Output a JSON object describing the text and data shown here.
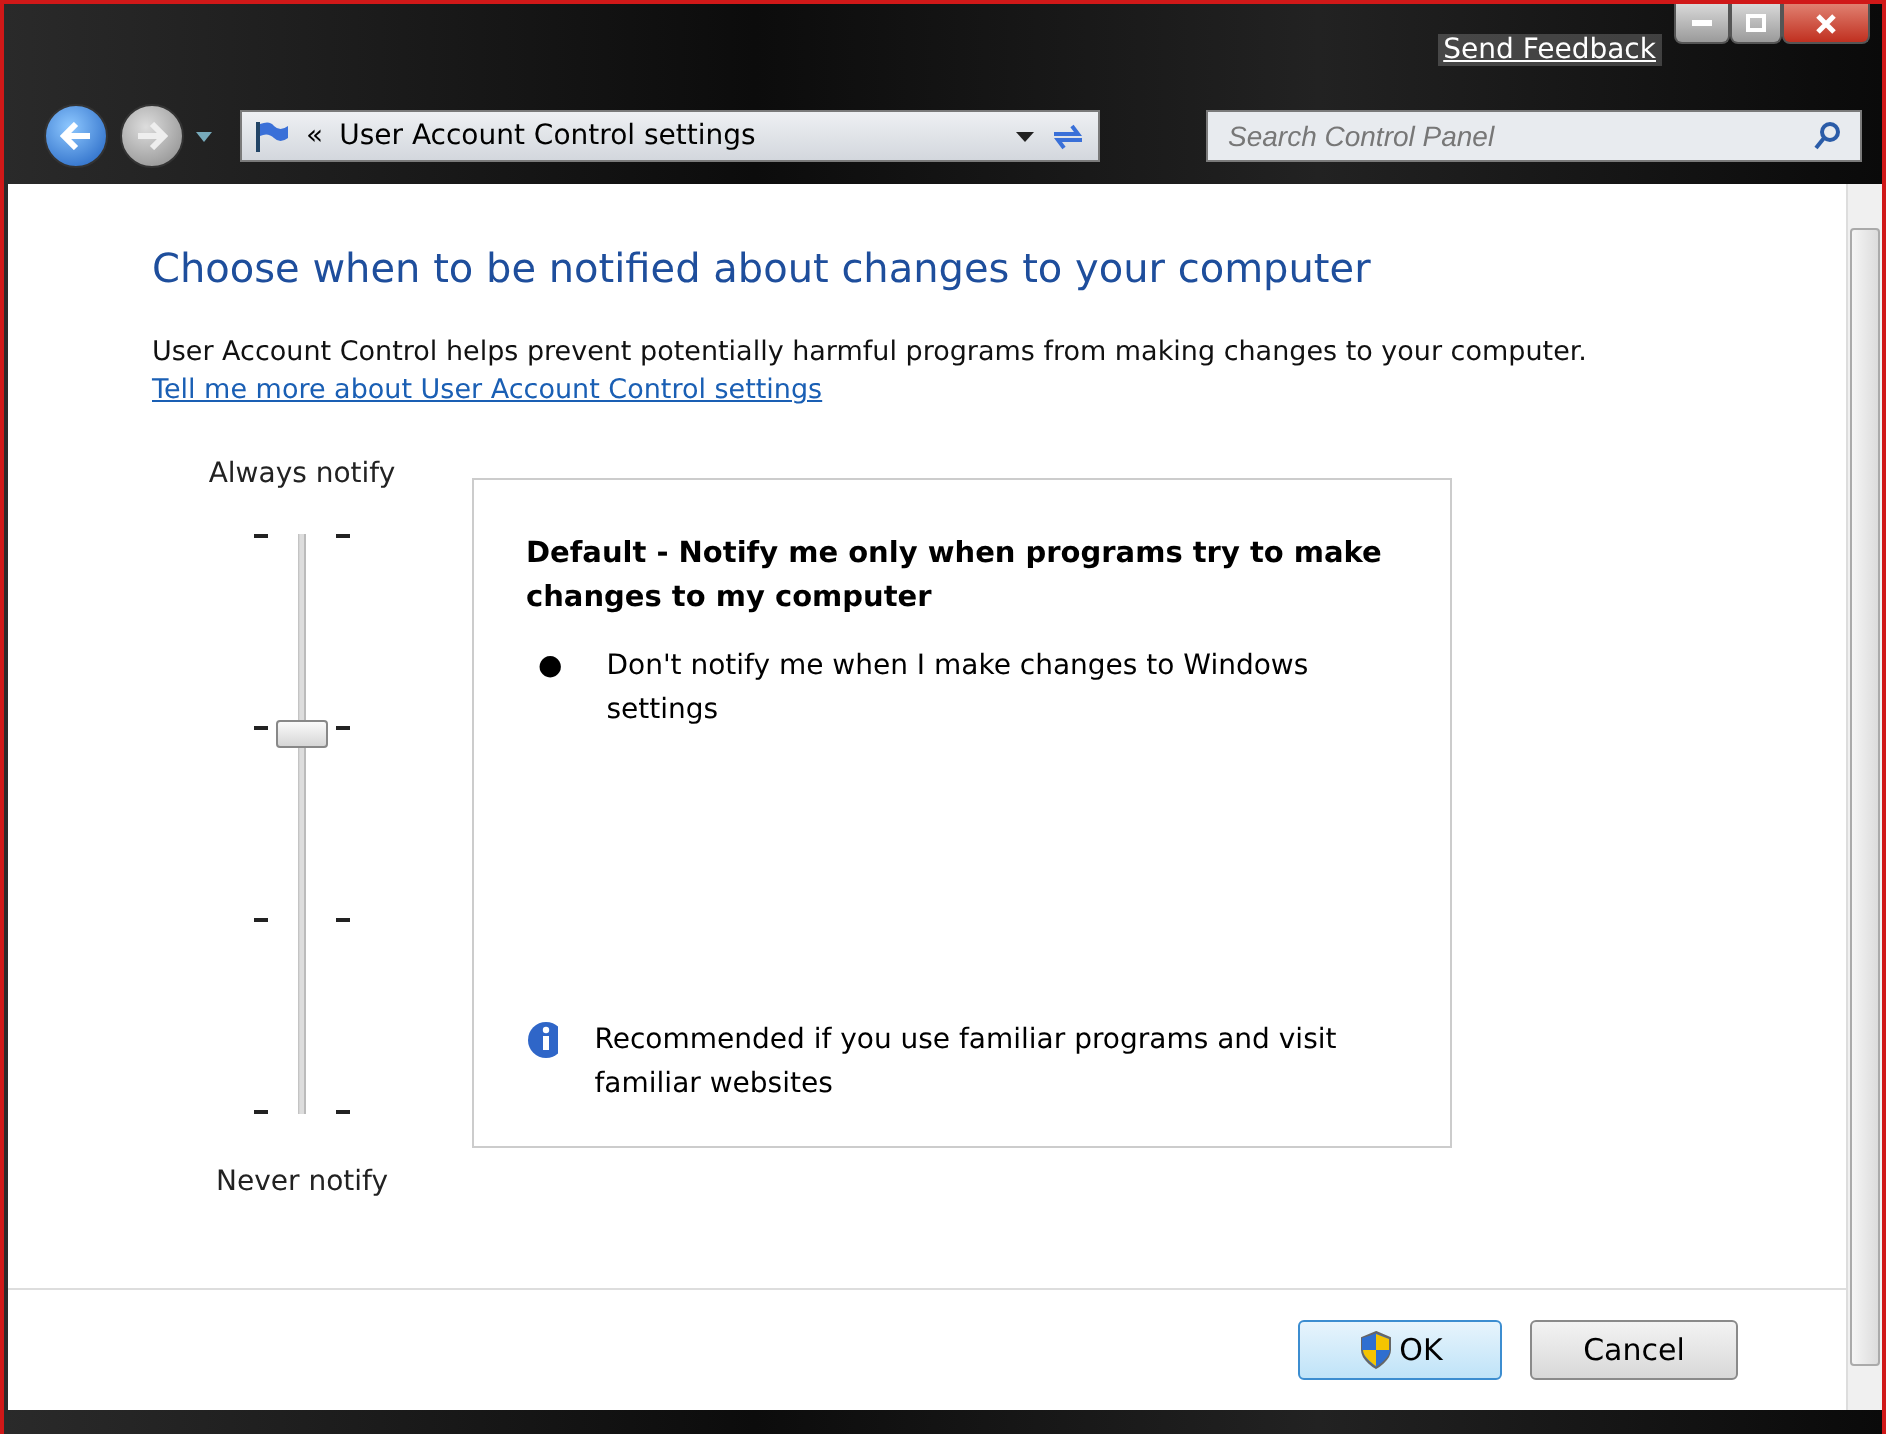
{
  "title_bar": {
    "feedback_link": "Send Feedback"
  },
  "nav": {
    "breadcrumb_prefix": "«",
    "breadcrumb": "User Account Control settings",
    "search": {
      "placeholder": "Search Control Panel"
    }
  },
  "heading": "Choose when to be notified about changes to your computer",
  "description": "User Account Control helps prevent potentially harmful programs from making changes to your computer.",
  "help_link": "Tell me more about User Account Control settings",
  "slider": {
    "top_label": "Always notify",
    "bottom_label": "Never notify",
    "level": 0.667
  },
  "panel": {
    "title": "Default - Notify me only when programs try to make changes to my computer",
    "bullets": [
      "Don't notify me when I make changes to Windows settings"
    ],
    "bullet_mark": "●",
    "note": "Recommended if you use familiar programs and visit familiar websites"
  },
  "buttons": [
    {
      "label": "OK",
      "shield": true
    },
    {
      "label": "Cancel",
      "shield": false
    }
  ]
}
